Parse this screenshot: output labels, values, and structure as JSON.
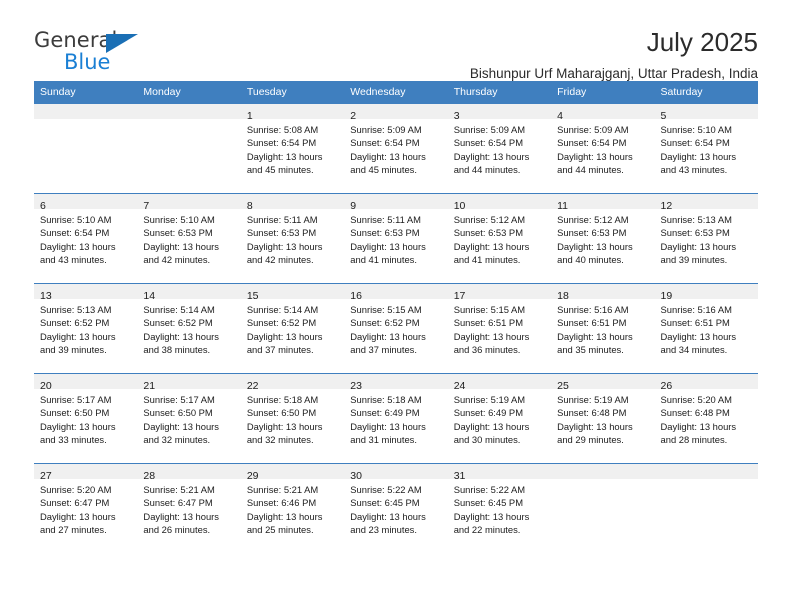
{
  "brand": {
    "word1": "General",
    "word2": "Blue",
    "triangle_color": "#1a6fb5",
    "word2_color": "#1a7fd4"
  },
  "header": {
    "title": "July 2025",
    "location": "Bishunpur Urf Maharajganj, Uttar Pradesh, India"
  },
  "theme": {
    "header_bar": "#3f7fbf",
    "daynum_band": "#f0f0f0",
    "grid_line": "#3f7fbf"
  },
  "weekday_headers": [
    "Sunday",
    "Monday",
    "Tuesday",
    "Wednesday",
    "Thursday",
    "Friday",
    "Saturday"
  ],
  "weeks": [
    [
      {
        "day": "",
        "l1": "",
        "l2": "",
        "l3": "",
        "l4": ""
      },
      {
        "day": "",
        "l1": "",
        "l2": "",
        "l3": "",
        "l4": ""
      },
      {
        "day": "1",
        "l1": "Sunrise: 5:08 AM",
        "l2": "Sunset: 6:54 PM",
        "l3": "Daylight: 13 hours",
        "l4": "and 45 minutes."
      },
      {
        "day": "2",
        "l1": "Sunrise: 5:09 AM",
        "l2": "Sunset: 6:54 PM",
        "l3": "Daylight: 13 hours",
        "l4": "and 45 minutes."
      },
      {
        "day": "3",
        "l1": "Sunrise: 5:09 AM",
        "l2": "Sunset: 6:54 PM",
        "l3": "Daylight: 13 hours",
        "l4": "and 44 minutes."
      },
      {
        "day": "4",
        "l1": "Sunrise: 5:09 AM",
        "l2": "Sunset: 6:54 PM",
        "l3": "Daylight: 13 hours",
        "l4": "and 44 minutes."
      },
      {
        "day": "5",
        "l1": "Sunrise: 5:10 AM",
        "l2": "Sunset: 6:54 PM",
        "l3": "Daylight: 13 hours",
        "l4": "and 43 minutes."
      }
    ],
    [
      {
        "day": "6",
        "l1": "Sunrise: 5:10 AM",
        "l2": "Sunset: 6:54 PM",
        "l3": "Daylight: 13 hours",
        "l4": "and 43 minutes."
      },
      {
        "day": "7",
        "l1": "Sunrise: 5:10 AM",
        "l2": "Sunset: 6:53 PM",
        "l3": "Daylight: 13 hours",
        "l4": "and 42 minutes."
      },
      {
        "day": "8",
        "l1": "Sunrise: 5:11 AM",
        "l2": "Sunset: 6:53 PM",
        "l3": "Daylight: 13 hours",
        "l4": "and 42 minutes."
      },
      {
        "day": "9",
        "l1": "Sunrise: 5:11 AM",
        "l2": "Sunset: 6:53 PM",
        "l3": "Daylight: 13 hours",
        "l4": "and 41 minutes."
      },
      {
        "day": "10",
        "l1": "Sunrise: 5:12 AM",
        "l2": "Sunset: 6:53 PM",
        "l3": "Daylight: 13 hours",
        "l4": "and 41 minutes."
      },
      {
        "day": "11",
        "l1": "Sunrise: 5:12 AM",
        "l2": "Sunset: 6:53 PM",
        "l3": "Daylight: 13 hours",
        "l4": "and 40 minutes."
      },
      {
        "day": "12",
        "l1": "Sunrise: 5:13 AM",
        "l2": "Sunset: 6:53 PM",
        "l3": "Daylight: 13 hours",
        "l4": "and 39 minutes."
      }
    ],
    [
      {
        "day": "13",
        "l1": "Sunrise: 5:13 AM",
        "l2": "Sunset: 6:52 PM",
        "l3": "Daylight: 13 hours",
        "l4": "and 39 minutes."
      },
      {
        "day": "14",
        "l1": "Sunrise: 5:14 AM",
        "l2": "Sunset: 6:52 PM",
        "l3": "Daylight: 13 hours",
        "l4": "and 38 minutes."
      },
      {
        "day": "15",
        "l1": "Sunrise: 5:14 AM",
        "l2": "Sunset: 6:52 PM",
        "l3": "Daylight: 13 hours",
        "l4": "and 37 minutes."
      },
      {
        "day": "16",
        "l1": "Sunrise: 5:15 AM",
        "l2": "Sunset: 6:52 PM",
        "l3": "Daylight: 13 hours",
        "l4": "and 37 minutes."
      },
      {
        "day": "17",
        "l1": "Sunrise: 5:15 AM",
        "l2": "Sunset: 6:51 PM",
        "l3": "Daylight: 13 hours",
        "l4": "and 36 minutes."
      },
      {
        "day": "18",
        "l1": "Sunrise: 5:16 AM",
        "l2": "Sunset: 6:51 PM",
        "l3": "Daylight: 13 hours",
        "l4": "and 35 minutes."
      },
      {
        "day": "19",
        "l1": "Sunrise: 5:16 AM",
        "l2": "Sunset: 6:51 PM",
        "l3": "Daylight: 13 hours",
        "l4": "and 34 minutes."
      }
    ],
    [
      {
        "day": "20",
        "l1": "Sunrise: 5:17 AM",
        "l2": "Sunset: 6:50 PM",
        "l3": "Daylight: 13 hours",
        "l4": "and 33 minutes."
      },
      {
        "day": "21",
        "l1": "Sunrise: 5:17 AM",
        "l2": "Sunset: 6:50 PM",
        "l3": "Daylight: 13 hours",
        "l4": "and 32 minutes."
      },
      {
        "day": "22",
        "l1": "Sunrise: 5:18 AM",
        "l2": "Sunset: 6:50 PM",
        "l3": "Daylight: 13 hours",
        "l4": "and 32 minutes."
      },
      {
        "day": "23",
        "l1": "Sunrise: 5:18 AM",
        "l2": "Sunset: 6:49 PM",
        "l3": "Daylight: 13 hours",
        "l4": "and 31 minutes."
      },
      {
        "day": "24",
        "l1": "Sunrise: 5:19 AM",
        "l2": "Sunset: 6:49 PM",
        "l3": "Daylight: 13 hours",
        "l4": "and 30 minutes."
      },
      {
        "day": "25",
        "l1": "Sunrise: 5:19 AM",
        "l2": "Sunset: 6:48 PM",
        "l3": "Daylight: 13 hours",
        "l4": "and 29 minutes."
      },
      {
        "day": "26",
        "l1": "Sunrise: 5:20 AM",
        "l2": "Sunset: 6:48 PM",
        "l3": "Daylight: 13 hours",
        "l4": "and 28 minutes."
      }
    ],
    [
      {
        "day": "27",
        "l1": "Sunrise: 5:20 AM",
        "l2": "Sunset: 6:47 PM",
        "l3": "Daylight: 13 hours",
        "l4": "and 27 minutes."
      },
      {
        "day": "28",
        "l1": "Sunrise: 5:21 AM",
        "l2": "Sunset: 6:47 PM",
        "l3": "Daylight: 13 hours",
        "l4": "and 26 minutes."
      },
      {
        "day": "29",
        "l1": "Sunrise: 5:21 AM",
        "l2": "Sunset: 6:46 PM",
        "l3": "Daylight: 13 hours",
        "l4": "and 25 minutes."
      },
      {
        "day": "30",
        "l1": "Sunrise: 5:22 AM",
        "l2": "Sunset: 6:45 PM",
        "l3": "Daylight: 13 hours",
        "l4": "and 23 minutes."
      },
      {
        "day": "31",
        "l1": "Sunrise: 5:22 AM",
        "l2": "Sunset: 6:45 PM",
        "l3": "Daylight: 13 hours",
        "l4": "and 22 minutes."
      },
      {
        "day": "",
        "l1": "",
        "l2": "",
        "l3": "",
        "l4": ""
      },
      {
        "day": "",
        "l1": "",
        "l2": "",
        "l3": "",
        "l4": ""
      }
    ]
  ]
}
